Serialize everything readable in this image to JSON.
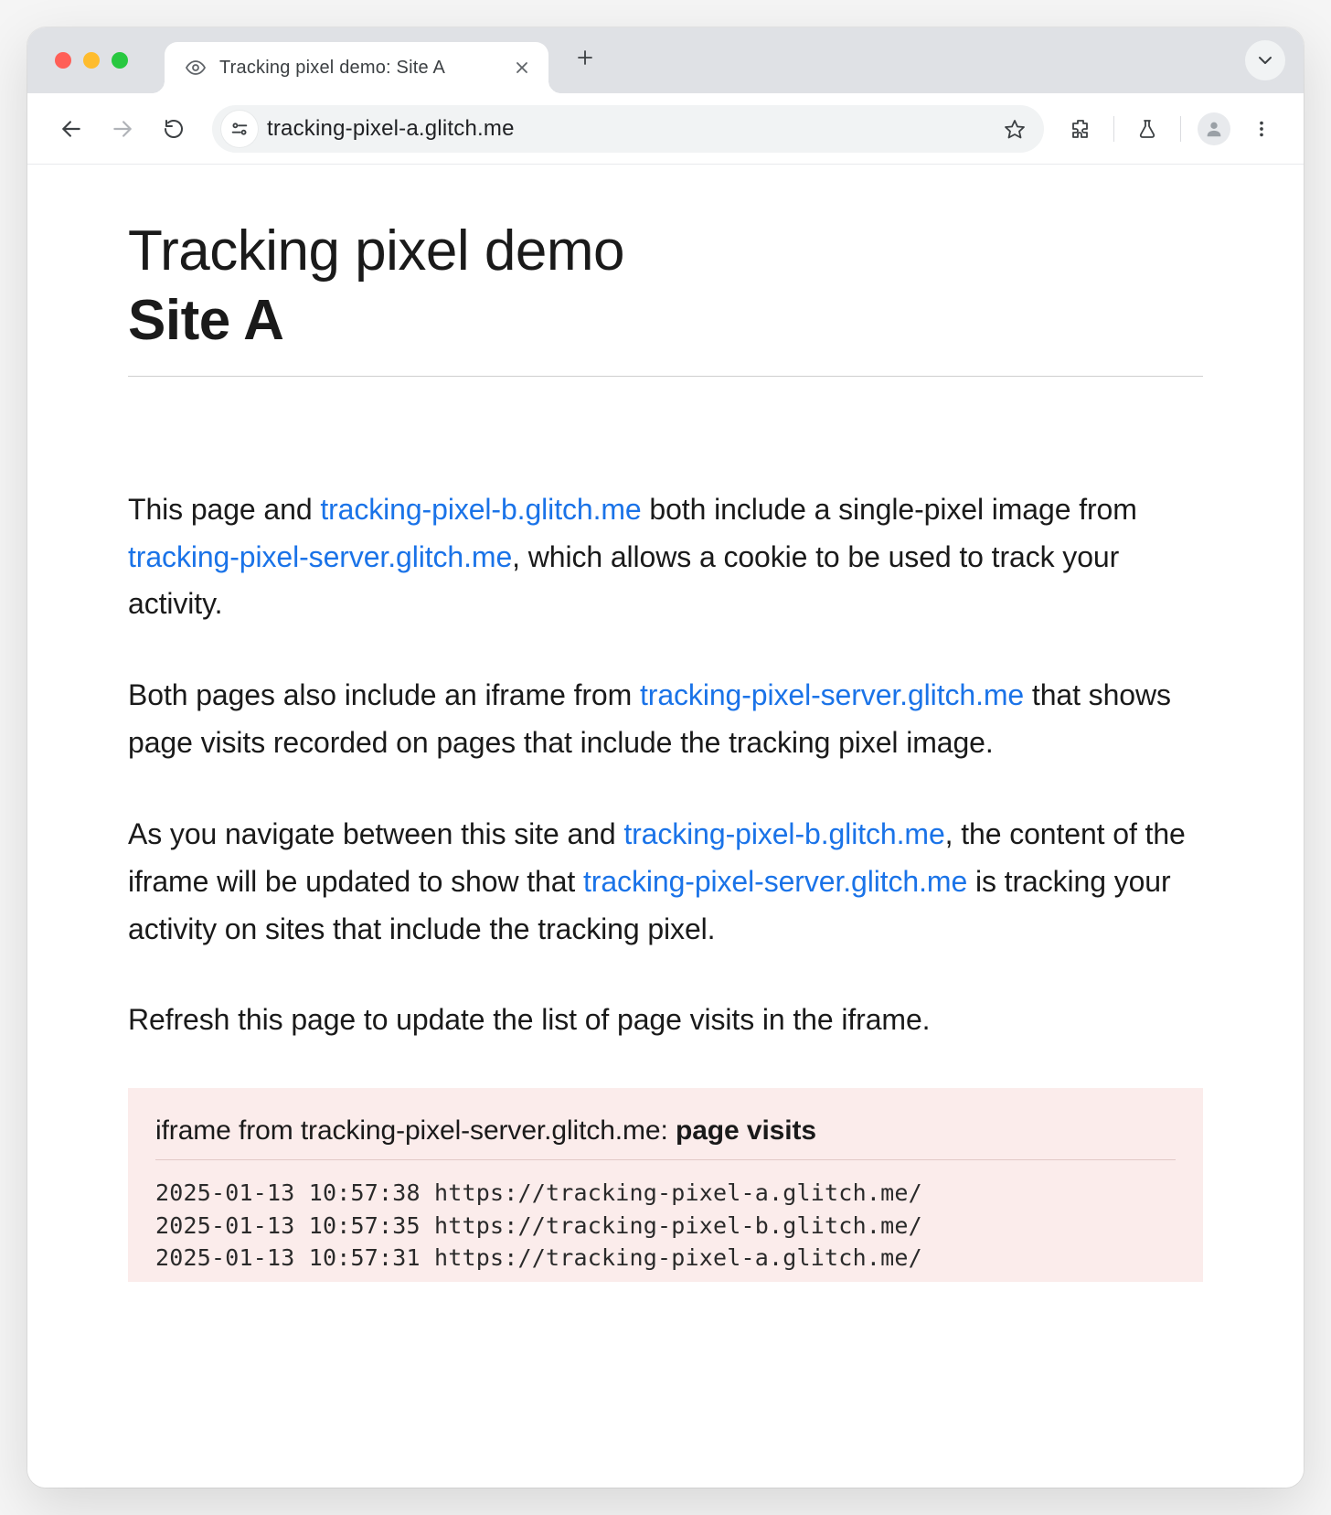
{
  "browser": {
    "tab_title": "Tracking pixel demo: Site A",
    "url": "tracking-pixel-a.glitch.me"
  },
  "page": {
    "title_line1": "Tracking pixel demo",
    "title_line2": "Site A",
    "p1": {
      "t1": "This page and ",
      "link1": "tracking-pixel-b.glitch.me",
      "t2": " both include a single-pixel image from ",
      "link2": "tracking-pixel-server.glitch.me",
      "t3": ", which allows a cookie to be used to track your activity."
    },
    "p2": {
      "t1": "Both pages also include an iframe from ",
      "link1": "tracking-pixel-server.glitch.me",
      "t2": " that shows page visits recorded on pages that include the tracking pixel image."
    },
    "p3": {
      "t1": "As you navigate between this site and ",
      "link1": "tracking-pixel-b.glitch.me",
      "t2": ", the content of the iframe will be updated to show that ",
      "link2": "tracking-pixel-server.glitch.me",
      "t3": " is tracking your activity on sites that include the tracking pixel."
    },
    "p4": "Refresh this page to update the list of page visits in the iframe."
  },
  "iframe": {
    "title_prefix": "iframe from tracking-pixel-server.glitch.me: ",
    "title_bold": "page visits",
    "log": [
      "2025-01-13 10:57:38 https://tracking-pixel-a.glitch.me/",
      "2025-01-13 10:57:35 https://tracking-pixel-b.glitch.me/",
      "2025-01-13 10:57:31 https://tracking-pixel-a.glitch.me/"
    ]
  }
}
